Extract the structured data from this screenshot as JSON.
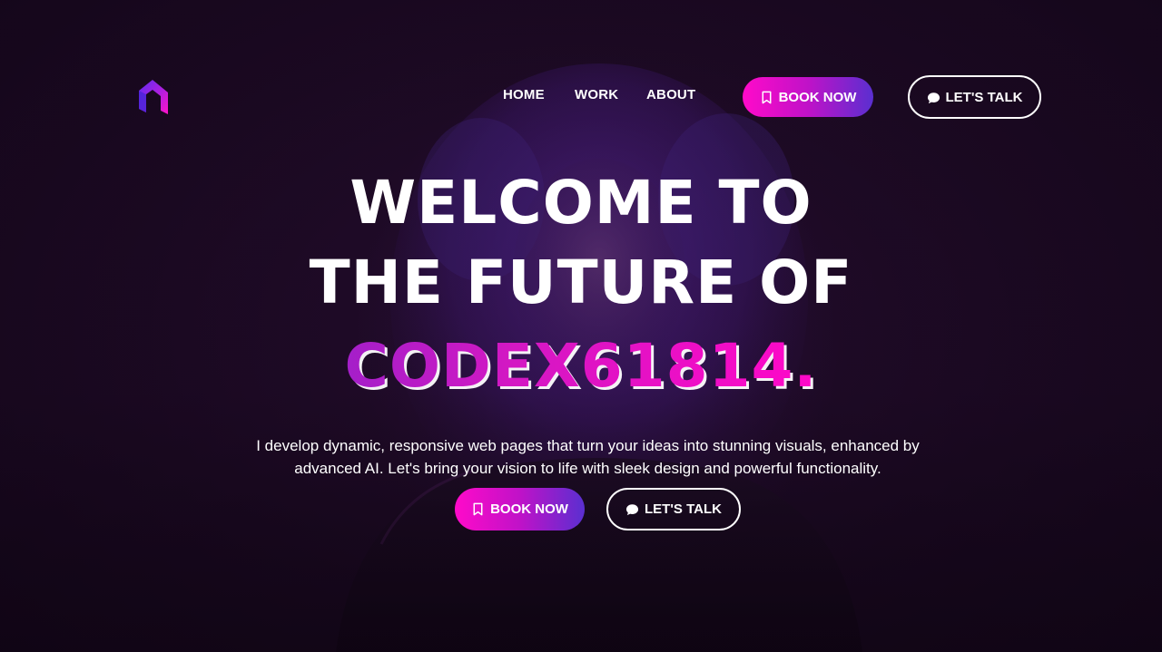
{
  "nav": {
    "logo_alt": "logo",
    "links": [
      "HOME",
      "WORK",
      "ABOUT"
    ],
    "book_label": "BOOK NOW",
    "talk_label": "LET'S TALK"
  },
  "hero": {
    "line1": "WELCOME TO",
    "line2": "THE FUTURE OF",
    "line3": "CODEX61814.",
    "description": "I develop dynamic, responsive web pages that turn your ideas into stunning visuals, enhanced by advanced AI. Let's bring your vision to life with sleek design and powerful functionality.",
    "book_label": "BOOK NOW",
    "talk_label": "LET'S TALK"
  },
  "icons": {
    "logo": "brand-logo-icon",
    "book": "bookmark-icon",
    "talk": "chat-bubble-icon"
  },
  "colors": {
    "background": "#1a0b1f",
    "accent_pink": "#ff0ac9",
    "accent_purple": "#5a2fd0",
    "brand_gradient_start": "#a41fc9",
    "brand_gradient_end": "#ff08c8",
    "text": "#ffffff"
  }
}
